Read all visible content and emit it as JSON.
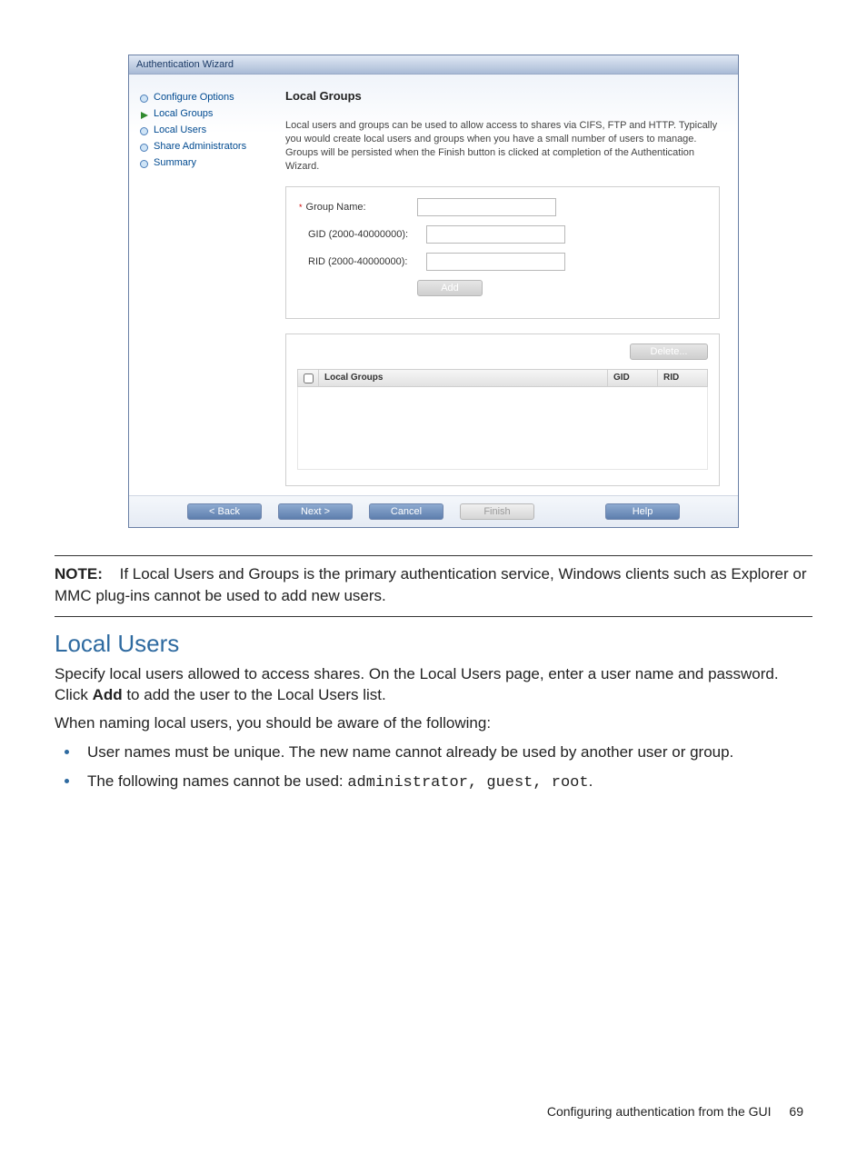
{
  "wizard": {
    "title": "Authentication Wizard",
    "sidebar": {
      "items": [
        {
          "label": "Configure Options",
          "current": false
        },
        {
          "label": "Local Groups",
          "current": true
        },
        {
          "label": "Local Users",
          "current": false
        },
        {
          "label": "Share Administrators",
          "current": false
        },
        {
          "label": "Summary",
          "current": false
        }
      ]
    },
    "main": {
      "heading": "Local Groups",
      "description": "Local users and groups can be used to allow access to shares via CIFS, FTP and HTTP. Typically you would create local users and groups when you have a small number of users to manage. Groups will be persisted when the Finish button is clicked at completion of the Authentication Wizard.",
      "form": {
        "group_name_label": "Group Name:",
        "gid_label": "GID (2000-40000000):",
        "rid_label": "RID (2000-40000000):",
        "add_label": "Add"
      },
      "table": {
        "delete_label": "Delete...",
        "col_name": "Local Groups",
        "col_gid": "GID",
        "col_rid": "RID"
      }
    },
    "footer": {
      "back": "< Back",
      "next": "Next >",
      "cancel": "Cancel",
      "finish": "Finish",
      "help": "Help"
    }
  },
  "doc": {
    "note_label": "NOTE:",
    "note_text": "If Local Users and Groups is the primary authentication service, Windows clients such as Explorer or MMC plug-ins cannot be used to add new users.",
    "h2": "Local Users",
    "p1_a": "Specify local users allowed to access shares. On the Local Users page, enter a user name and password. Click ",
    "p1_bold": "Add",
    "p1_b": " to add the user to the Local Users list.",
    "p2": "When naming local users, you should be aware of the following:",
    "li1": "User names must be unique. The new name cannot already be used by another user or group.",
    "li2_a": "The following names cannot be used: ",
    "li2_code": "administrator, guest, root",
    "li2_b": ".",
    "footer_text": "Configuring authentication from the GUI",
    "page_num": "69"
  }
}
